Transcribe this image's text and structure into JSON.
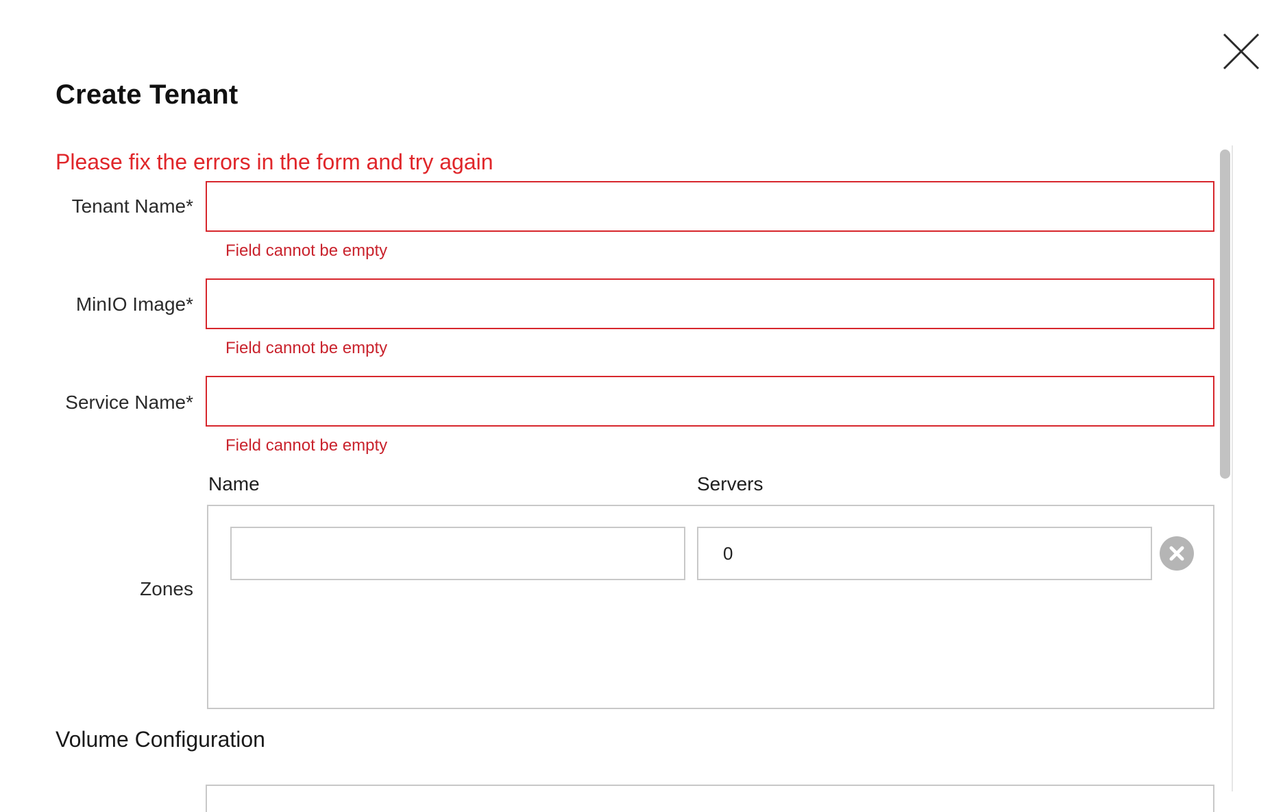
{
  "dialog": {
    "title": "Create Tenant",
    "close_icon": "close-icon"
  },
  "form": {
    "error_summary": "Please fix the errors in the form and try again",
    "fields": [
      {
        "label": "Tenant Name*",
        "value": "",
        "error": "Field cannot be empty"
      },
      {
        "label": "MinIO Image*",
        "value": "",
        "error": "Field cannot be empty"
      },
      {
        "label": "Service Name*",
        "value": "",
        "error": "Field cannot be empty"
      }
    ],
    "zones": {
      "label": "Zones",
      "columns": {
        "name": "Name",
        "servers": "Servers"
      },
      "rows": [
        {
          "name": "",
          "servers": "0",
          "remove_icon": "remove-circle-icon"
        }
      ]
    },
    "volume_configuration": {
      "title": "Volume Configuration"
    }
  },
  "colors": {
    "error": "#d7262c",
    "border": "#c8c8c8",
    "scrollbar": "#c2c2c2",
    "remove_button": "#b5b5b5"
  }
}
